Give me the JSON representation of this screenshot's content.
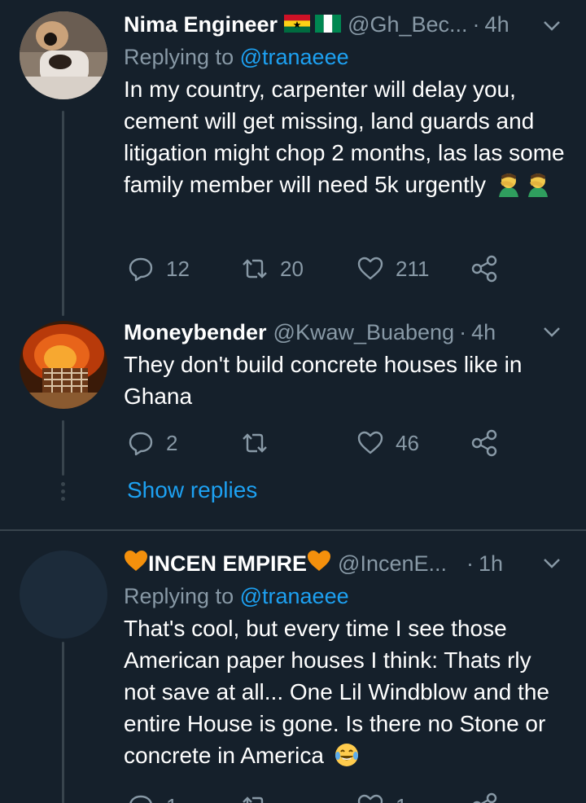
{
  "tweets": [
    {
      "name": "Nima Engineer",
      "handle": "@Gh_Bec...",
      "dot": "·",
      "time": "4h",
      "reply_prefix": "Replying to",
      "reply_mention": "@tranaeee",
      "text": "In my country, carpenter will delay you, cement will get missing, land guards and litigation might chop 2 months, las las some family member will need 5k urgently",
      "emoji": [
        "facepalm",
        "facepalm"
      ],
      "replies": "12",
      "retweets": "20",
      "likes": "211"
    },
    {
      "name": "Moneybender",
      "handle": "@Kwaw_Buabeng",
      "dot": "·",
      "time": "4h",
      "text": "They don't build concrete houses like in Ghana",
      "replies": "2",
      "retweets": "",
      "likes": "46"
    },
    {
      "name": "INCEN EMPIRE",
      "handle": "@IncenE...",
      "dot": "·",
      "time": "1h",
      "reply_prefix": "Replying to",
      "reply_mention": "@tranaeee",
      "text": "That's cool, but every time I see those American paper houses I think: Thats rly not save at all... One Lil Windblow and the entire House is gone. Is there no Stone or concrete in America",
      "emoji": [
        "tears-of-joy"
      ],
      "replies": "1",
      "retweets": "",
      "likes": "1"
    }
  ],
  "show_replies": "Show replies",
  "colors": {
    "background": "#15202b",
    "secondary_text": "#8899a6",
    "accent": "#1da1f2",
    "divider": "#38444d"
  }
}
